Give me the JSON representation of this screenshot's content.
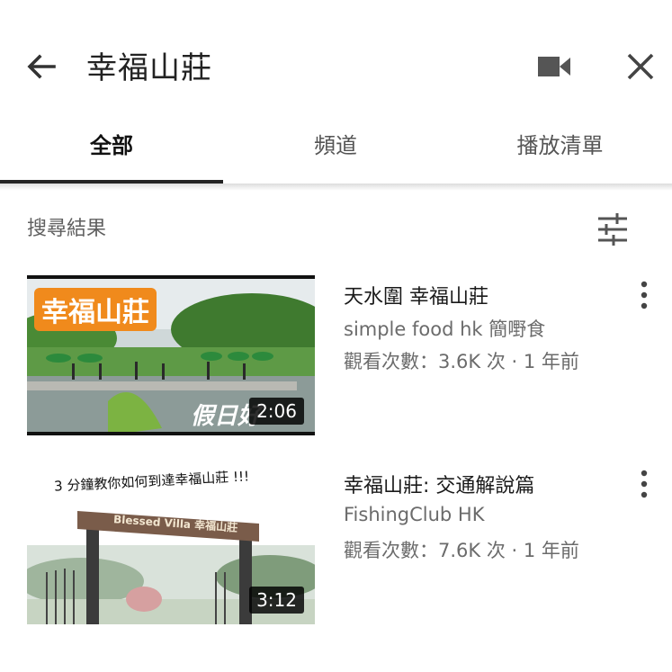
{
  "search": {
    "query": "幸福山莊"
  },
  "tabs": [
    {
      "label": "全部",
      "active": true
    },
    {
      "label": "頻道",
      "active": false
    },
    {
      "label": "播放清單",
      "active": false
    }
  ],
  "results_heading": "搜尋結果",
  "videos": [
    {
      "title": "天水圍 幸福山莊",
      "channel": "simple food hk 簡嘢食",
      "meta": "觀看次數：3.6K 次 · 1 年前",
      "duration": "2:06",
      "thumb_text_1": "幸福山莊",
      "thumb_text_2": "假日好"
    },
    {
      "title": "幸福山莊: 交通解說篇",
      "channel": "FishingClub HK",
      "meta": "觀看次數：7.6K 次 · 1 年前",
      "duration": "3:12",
      "thumb_text_1": "3 分鐘教你如何到達幸福山莊 !!!",
      "thumb_text_2": "Blessed Villa 幸福山莊"
    }
  ],
  "icons": {
    "back": "arrow-left-icon",
    "camera": "video-camera-icon",
    "close": "close-icon",
    "filter": "filter-sliders-icon",
    "more": "more-vertical-icon"
  },
  "colors": {
    "text_primary": "#1a1a1a",
    "text_secondary": "#6b6b6b",
    "tab_indicator": "#222222"
  }
}
